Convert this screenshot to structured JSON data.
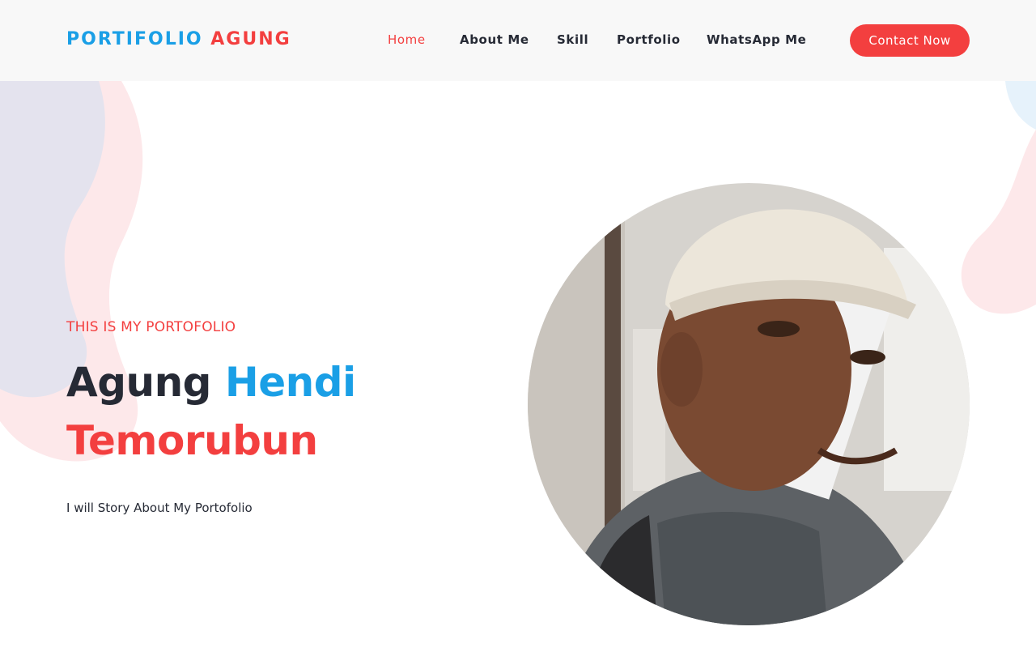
{
  "brand": {
    "part1": "PORTIFOLIO",
    "part2": "AGUNG"
  },
  "nav": {
    "items": [
      {
        "label": "Home",
        "active": true
      },
      {
        "label": "About Me",
        "active": false
      },
      {
        "label": "Skill",
        "active": false
      },
      {
        "label": "Portfolio",
        "active": false
      },
      {
        "label": "WhatsApp Me",
        "active": false
      }
    ],
    "cta_label": "Contact Now"
  },
  "hero": {
    "eyebrow": "THIS IS MY PORTOFOLIO",
    "name_first": "Agung",
    "name_middle": "Hendi",
    "name_last": "Temorubun",
    "tagline": "I will Story About My Portofolio"
  },
  "colors": {
    "accent_red": "#f33f3f",
    "accent_blue": "#1a9fe6",
    "text_dark": "#262a35",
    "header_bg": "#f8f8f8"
  },
  "images": {
    "portrait": "profile-photo"
  }
}
